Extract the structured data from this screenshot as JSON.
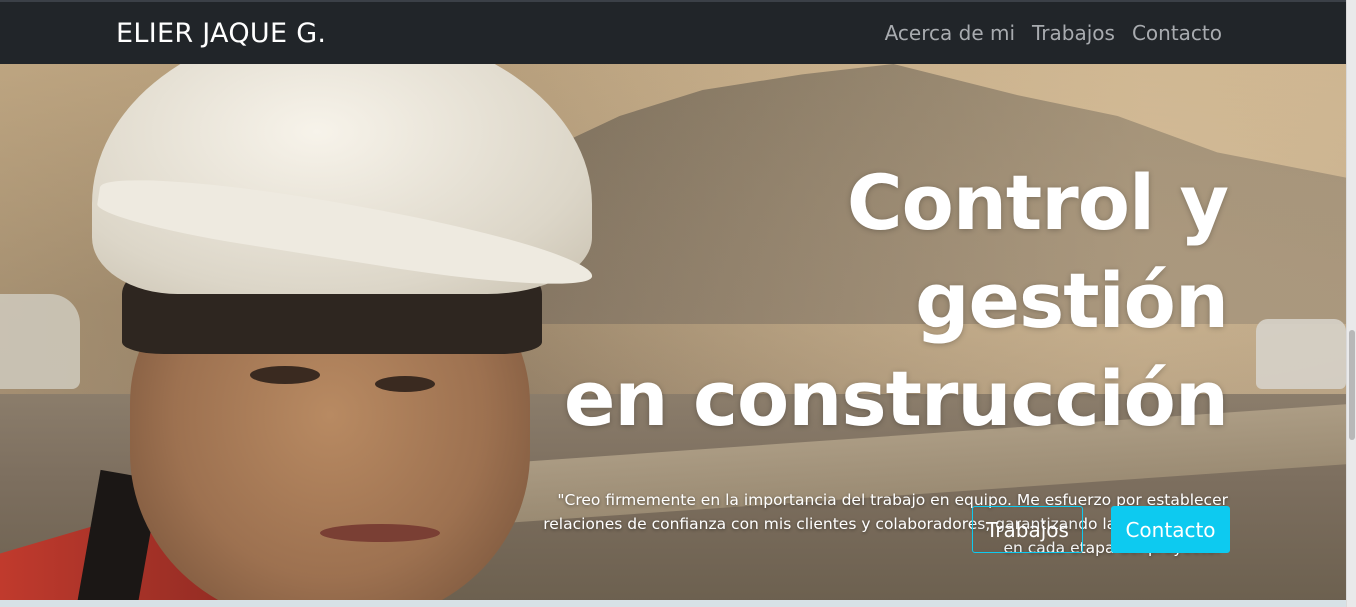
{
  "navbar": {
    "brand": "ELIER JAQUE G.",
    "links": [
      "Acerca de mi",
      "Trabajos",
      "Contacto"
    ]
  },
  "hero": {
    "headline_line1": "Control y gestión",
    "headline_line2": "en construcción",
    "quote_line1": "\"Creo firmemente en la importancia del trabajo en equipo. Me esfuerzo por establecer",
    "quote_line2": "relaciones de confianza con mis clientes y colaboradores, garantizando la transparencia",
    "quote_line3": "en cada etapa del proyecto.\"",
    "buttons": {
      "works": "Trabajos",
      "contact": "Contacto"
    }
  },
  "colors": {
    "navbar_bg": "#212529",
    "accent": "#0dcaf0"
  }
}
